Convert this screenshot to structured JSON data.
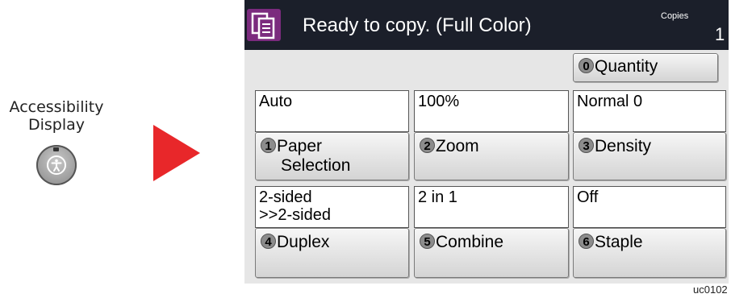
{
  "accessibility": {
    "line1": "Accessibility",
    "line2": "Display"
  },
  "screen": {
    "title": "Ready to copy. (Full Color)",
    "copies_label": "Copies",
    "copies_value": "1",
    "quantity": {
      "num": "0",
      "label": "Quantity"
    },
    "settings": [
      {
        "value": "Auto",
        "num": "1",
        "label_line1": "Paper",
        "label_line2": "Selection"
      },
      {
        "value": "100%",
        "num": "2",
        "label_line1": "Zoom",
        "label_line2": ""
      },
      {
        "value": "Normal 0",
        "num": "3",
        "label_line1": "Density",
        "label_line2": ""
      },
      {
        "value": "2-sided",
        "value_line2": ">>2-sided",
        "num": "4",
        "label_line1": "Duplex",
        "label_line2": ""
      },
      {
        "value": "2 in 1",
        "num": "5",
        "label_line1": "Combine",
        "label_line2": ""
      },
      {
        "value": "Off",
        "num": "6",
        "label_line1": "Staple",
        "label_line2": ""
      }
    ]
  },
  "colors": {
    "titlebar": "#1b1f2a",
    "mode_icon": "#7b2b7e",
    "arrow": "#e8272a"
  },
  "footer_code": "uc0102"
}
